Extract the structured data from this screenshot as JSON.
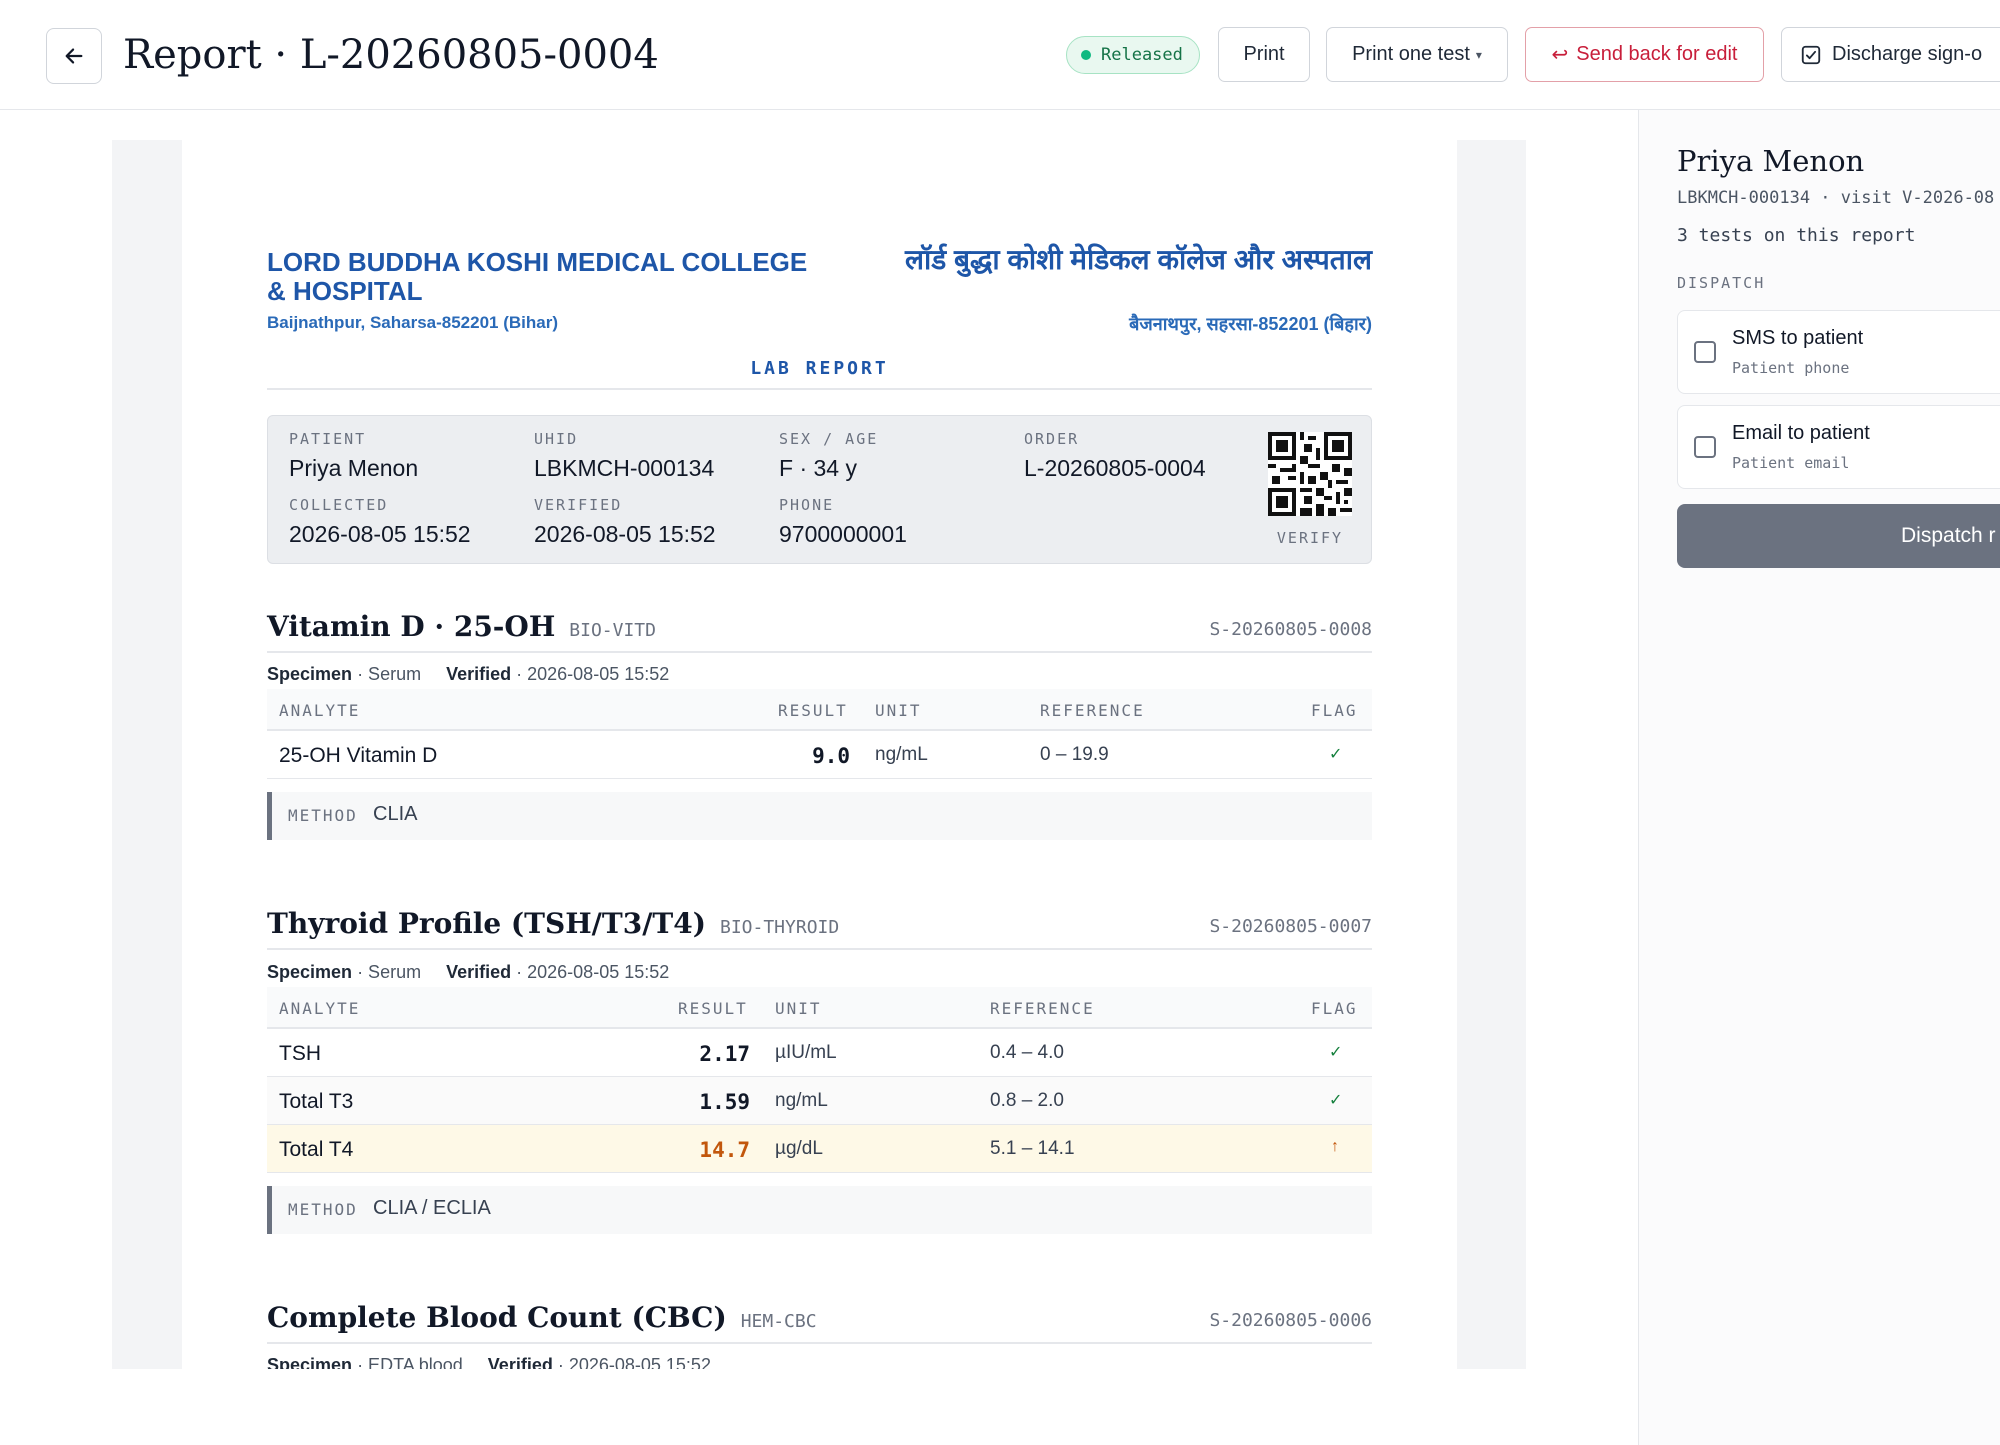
{
  "header": {
    "title": "Report · L-20260805-0004",
    "status": "Released",
    "print_label": "Print",
    "print_one_label": "Print one test",
    "send_back_label": "Send back for edit",
    "discharge_label": "Discharge sign-o"
  },
  "report": {
    "hospital_en": "LORD BUDDHA KOSHI MEDICAL COLLEGE & HOSPITAL",
    "address_en": "Baijnathpur, Saharsa-852201 (Bihar)",
    "hospital_hi": "लॉर्ड बुद्धा कोशी मेडिकल कॉलेज और अस्पताल",
    "address_hi": "बैजनाथपुर, सहरसा-852201 (बिहार)",
    "heading": "LAB REPORT",
    "patient": {
      "patient_label": "PATIENT",
      "patient": "Priya Menon",
      "uhid_label": "UHID",
      "uhid": "LBKMCH-000134",
      "sexage_label": "SEX / AGE",
      "sexage": "F · 34 y",
      "order_label": "ORDER",
      "order": "L-20260805-0004",
      "collected_label": "COLLECTED",
      "collected": "2026-08-05 15:52",
      "verified_label": "VERIFIED",
      "verified": "2026-08-05 15:52",
      "phone_label": "PHONE",
      "phone": "9700000001",
      "verify_label": "VERIFY"
    },
    "columns": {
      "analyte": "ANALYTE",
      "result": "RESULT",
      "unit": "UNIT",
      "reference": "REFERENCE",
      "flag": "FLAG"
    },
    "method_label": "METHOD",
    "specimen_label": "Specimen",
    "verified_label": "Verified",
    "tests": [
      {
        "title": "Vitamin D · 25-OH",
        "code": "BIO-VITD",
        "sample": "S-20260805-0008",
        "specimen": "· Serum",
        "verified": "· 2026-08-05 15:52",
        "rows": [
          {
            "analyte": "25-OH Vitamin D",
            "result": "9.0",
            "unit": "ng/mL",
            "reference": "0 – 19.9",
            "flag": "✓"
          }
        ],
        "method": "CLIA"
      },
      {
        "title": "Thyroid Profile (TSH/T3/T4)",
        "code": "BIO-THYROID",
        "sample": "S-20260805-0007",
        "specimen": "· Serum",
        "verified": "· 2026-08-05 15:52",
        "rows": [
          {
            "analyte": "TSH",
            "result": "2.17",
            "unit": "µIU/mL",
            "reference": "0.4 – 4.0",
            "flag": "✓"
          },
          {
            "analyte": "Total T3",
            "result": "1.59",
            "unit": "ng/mL",
            "reference": "0.8 – 2.0",
            "flag": "✓"
          },
          {
            "analyte": "Total T4",
            "result": "14.7",
            "unit": "µg/dL",
            "reference": "5.1 – 14.1",
            "flag": "↑"
          }
        ],
        "method": "CLIA / ECLIA"
      },
      {
        "title": "Complete Blood Count (CBC)",
        "code": "HEM-CBC",
        "sample": "S-20260805-0006",
        "specimen": "· EDTA blood",
        "verified": "· 2026-08-05 15:52"
      }
    ]
  },
  "sidebar": {
    "name": "Priya Menon",
    "ids": "LBKMCH-000134 · visit V-2026-08",
    "test_count": "3 tests on this report",
    "section": "DISPATCH",
    "options": [
      {
        "label": "SMS to patient",
        "sub": "Patient phone"
      },
      {
        "label": "Email to patient",
        "sub": "Patient email"
      }
    ],
    "dispatch_label": "Dispatch r"
  },
  "colors": {
    "brand_blue": "#1e56a8",
    "released_green": "#157347",
    "danger_red": "#c81e3a",
    "flag_high": "#c2570c"
  },
  "icons": [
    "back-arrow-icon",
    "status-dot-icon",
    "caret-down-icon",
    "undo-arrow-icon",
    "checkbox-icon",
    "qr-code-icon",
    "check-icon",
    "arrow-up-icon"
  ]
}
